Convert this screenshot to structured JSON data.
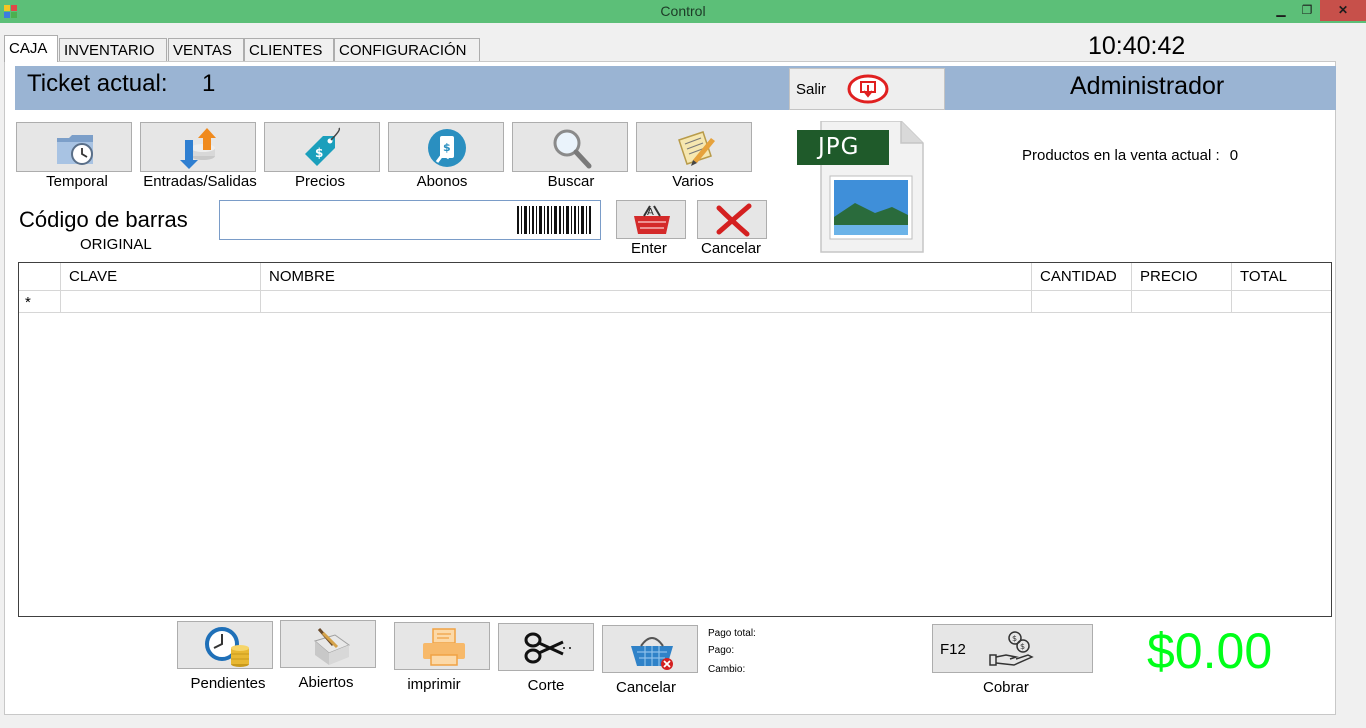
{
  "window": {
    "title": "Control",
    "minimize": "▁",
    "maximize": "❐",
    "close": "✕"
  },
  "tabs": [
    {
      "label": "CAJA",
      "active": true
    },
    {
      "label": "INVENTARIO"
    },
    {
      "label": "VENTAS"
    },
    {
      "label": "CLIENTES"
    },
    {
      "label": "CONFIGURACIÓN"
    }
  ],
  "clock": "10:40:42",
  "header": {
    "ticket_label": "Ticket actual:",
    "ticket_number": "1",
    "exit_label": "Salir",
    "user": "Administrador",
    "band_color": "#9ab4d3"
  },
  "toolbar": [
    {
      "label": "Temporal",
      "icon": "clock-folder-icon"
    },
    {
      "label": "Entradas/Salidas",
      "icon": "in-out-arrows-icon"
    },
    {
      "label": "Precios",
      "icon": "price-tag-icon"
    },
    {
      "label": "Abonos",
      "icon": "payment-hand-icon"
    },
    {
      "label": "Buscar",
      "icon": "magnifier-icon"
    },
    {
      "label": "Varios",
      "icon": "clipboard-pencil-icon"
    }
  ],
  "image_placeholder": {
    "badge": "JPG"
  },
  "products_in_sale": {
    "label": "Productos en la venta actual :",
    "count": "0"
  },
  "barcode": {
    "label": "Código de barras",
    "mode": "ORIGINAL",
    "value": "",
    "enter_label": "Enter",
    "cancel_label": "Cancelar"
  },
  "grid": {
    "columns": [
      "",
      "CLAVE",
      "NOMBRE",
      "CANTIDAD",
      "PRECIO",
      "TOTAL"
    ],
    "new_row_marker": "*",
    "rows": []
  },
  "bottom_buttons": [
    {
      "label": "Pendientes",
      "icon": "clock-coins-icon"
    },
    {
      "label": "Abiertos",
      "icon": "open-box-icon"
    },
    {
      "label": "imprimir",
      "icon": "printer-icon"
    },
    {
      "label": "Corte",
      "icon": "scissors-icon"
    },
    {
      "label": "Cancelar",
      "icon": "basket-cancel-icon"
    }
  ],
  "payment": {
    "total_label": "Pago total:",
    "paid_label": "Pago:",
    "change_label": "Cambio:",
    "cobrar_key": "F12",
    "cobrar_label": "Cobrar",
    "amount": "$0.00",
    "amount_color": "#00ff19"
  }
}
